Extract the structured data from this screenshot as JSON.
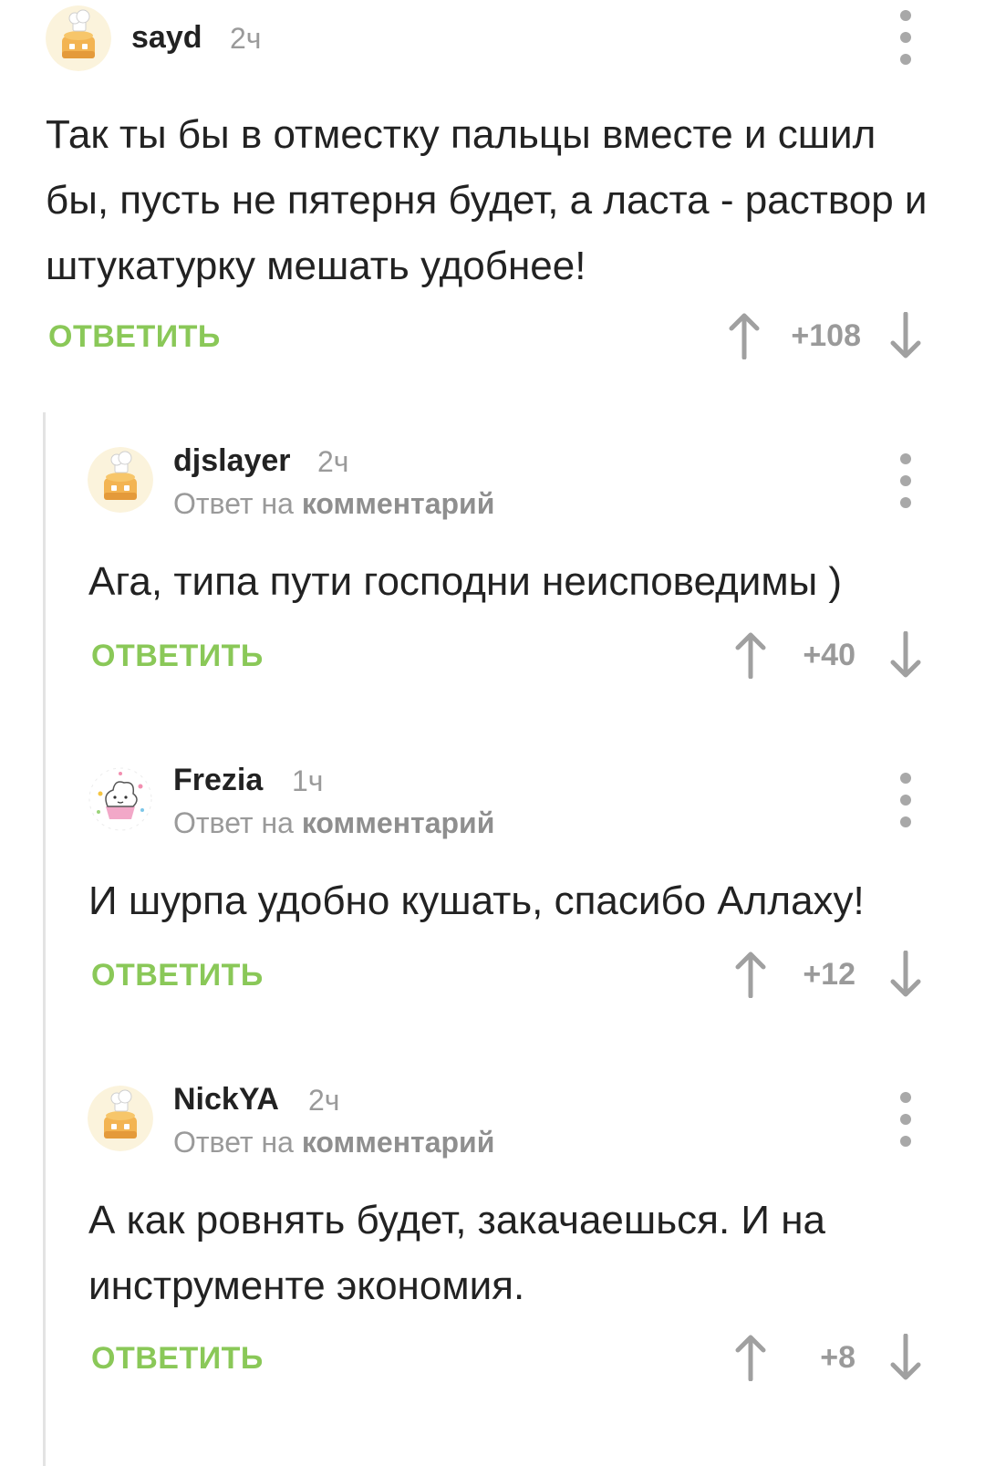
{
  "comments": [
    {
      "username": "sayd",
      "time": "2ч",
      "reply_to": null,
      "text": "Так ты бы в отместку пальцы вместе и сшил бы, пусть не пятерня будет, а ласта - раствор и штукатурку мешать удобнее!",
      "reply_label": "ОТВЕТИТЬ",
      "rating": "+108",
      "avatar": "chef-cake-avatar"
    },
    {
      "username": "djslayer",
      "time": "2ч",
      "reply_to": {
        "prefix": "Ответ на",
        "target": "комментарий"
      },
      "text": "Ага, типа пути господни неисповедимы )",
      "reply_label": "ОТВЕТИТЬ",
      "rating": "+40",
      "avatar": "chef-cake-avatar"
    },
    {
      "username": "Frezia",
      "time": "1ч",
      "reply_to": {
        "prefix": "Ответ на",
        "target": "комментарий"
      },
      "text": "И шурпа удобно кушать, спасибо Аллаху!",
      "reply_label": "ОТВЕТИТЬ",
      "rating": "+12",
      "avatar": "cupcake-avatar"
    },
    {
      "username": "NickYA",
      "time": "2ч",
      "reply_to": {
        "prefix": "Ответ на",
        "target": "комментарий"
      },
      "text": "А как ровнять будет, закачаешься. И на инструменте экономия.",
      "reply_label": "ОТВЕТИТЬ",
      "rating": "+8",
      "avatar": "chef-cake-avatar"
    }
  ],
  "colors": {
    "accent_green": "#8ac858",
    "muted_gray": "#9a9a9a",
    "text_dark": "#222222",
    "thread_line": "#e3e3e3"
  },
  "icons": {
    "upvote": "arrow-up-icon",
    "downvote": "arrow-down-icon",
    "more": "more-vertical-icon"
  }
}
